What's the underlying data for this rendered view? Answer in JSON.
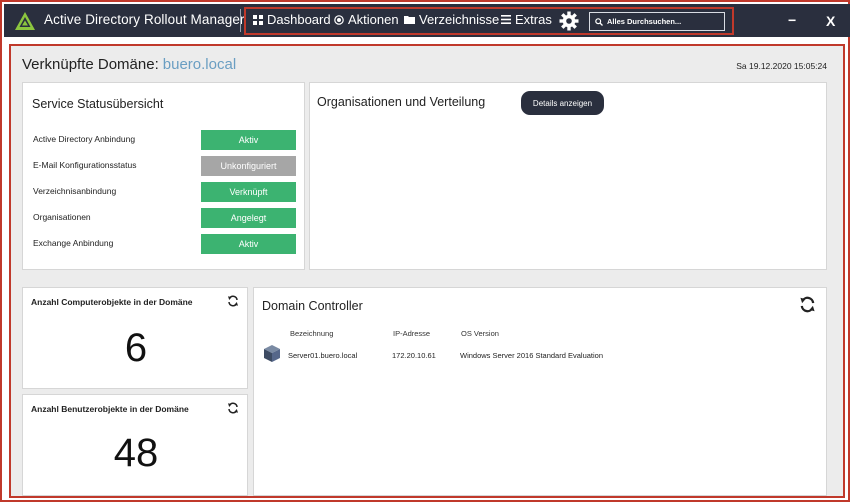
{
  "app": {
    "title": "Active Directory Rollout Manager"
  },
  "nav": {
    "dashboard": "Dashboard",
    "aktionen": "Aktionen",
    "verzeichnisse": "Verzeichnisse",
    "extras": "Extras"
  },
  "search": {
    "placeholder": "Alles Durchsuchen..."
  },
  "window": {
    "minimize": "−",
    "close": "X"
  },
  "header": {
    "domain_label": "Verknüpfte Domäne:",
    "domain_name": "buero.local",
    "datetime": "Sa 19.12.2020 15:05:24"
  },
  "status": {
    "title": "Service Statusübersicht",
    "rows": [
      {
        "label": "Active Directory Anbindung",
        "status": "Aktiv",
        "color": "#3cb371"
      },
      {
        "label": "E-Mail Konfigurationsstatus",
        "status": "Unkonfiguriert",
        "color": "#a6a6a6"
      },
      {
        "label": "Verzeichnisanbindung",
        "status": "Verknüpft",
        "color": "#3cb371"
      },
      {
        "label": "Organisationen",
        "status": "Angelegt",
        "color": "#3cb371"
      },
      {
        "label": "Exchange Anbindung",
        "status": "Aktiv",
        "color": "#3cb371"
      }
    ]
  },
  "org": {
    "title": "Organisationen und Verteilung",
    "details_button": "Details anzeigen"
  },
  "computer_count": {
    "title": "Anzahl Computerobjekte in der Domäne",
    "value": "6"
  },
  "user_count": {
    "title": "Anzahl Benutzerobjekte in der Domäne",
    "value": "48"
  },
  "dc": {
    "title": "Domain Controller",
    "columns": [
      "Bezeichnung",
      "IP-Adresse",
      "OS Version"
    ],
    "rows": [
      {
        "name": "Server01.buero.local",
        "ip": "172.20.10.61",
        "os": "Windows Server 2016 Standard Evaluation"
      }
    ]
  },
  "colors": {
    "accent": "#2a2f3e",
    "link": "#6a9ec2",
    "active": "#3cb371",
    "inactive": "#a6a6a6",
    "highlight": "#c0392b"
  }
}
